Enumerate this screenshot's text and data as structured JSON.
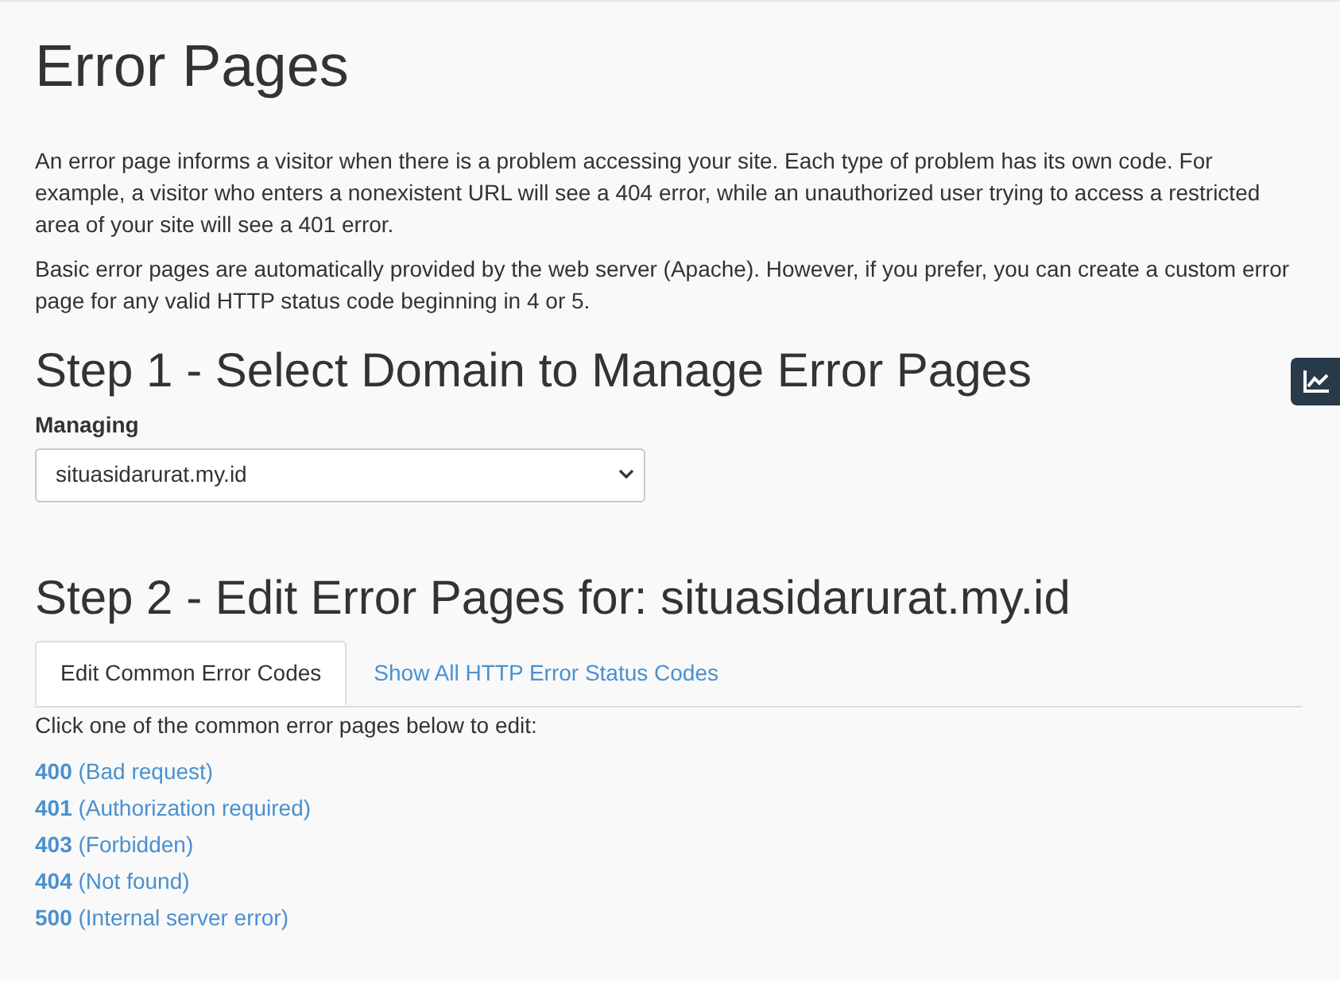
{
  "title": "Error Pages",
  "intro": [
    "An error page informs a visitor when there is a problem accessing your site. Each type of problem has its own code. For example, a visitor who enters a nonexistent URL will see a 404 error, while an unauthorized user trying to access a restricted area of your site will see a 401 error.",
    "Basic error pages are automatically provided by the web server (Apache). However, if you prefer, you can create a custom error page for any valid HTTP status code beginning in 4 or 5."
  ],
  "step1": {
    "heading": "Step 1 - Select Domain to Manage Error Pages",
    "label": "Managing",
    "value": "situasidarurat.my.id"
  },
  "step2": {
    "heading": "Step 2 - Edit Error Pages for: situasidarurat.my.id",
    "tabs": [
      {
        "label": "Edit Common Error Codes",
        "selected": true
      },
      {
        "label": "Show All HTTP Error Status Codes",
        "selected": false
      }
    ],
    "instruction": "Click one of the common error pages below to edit:",
    "links": [
      {
        "code": "400",
        "description": "(Bad request)"
      },
      {
        "code": "401",
        "description": "(Authorization required)"
      },
      {
        "code": "403",
        "description": "(Forbidden)"
      },
      {
        "code": "404",
        "description": "(Not found)"
      },
      {
        "code": "500",
        "description": "(Internal server error)"
      }
    ]
  }
}
